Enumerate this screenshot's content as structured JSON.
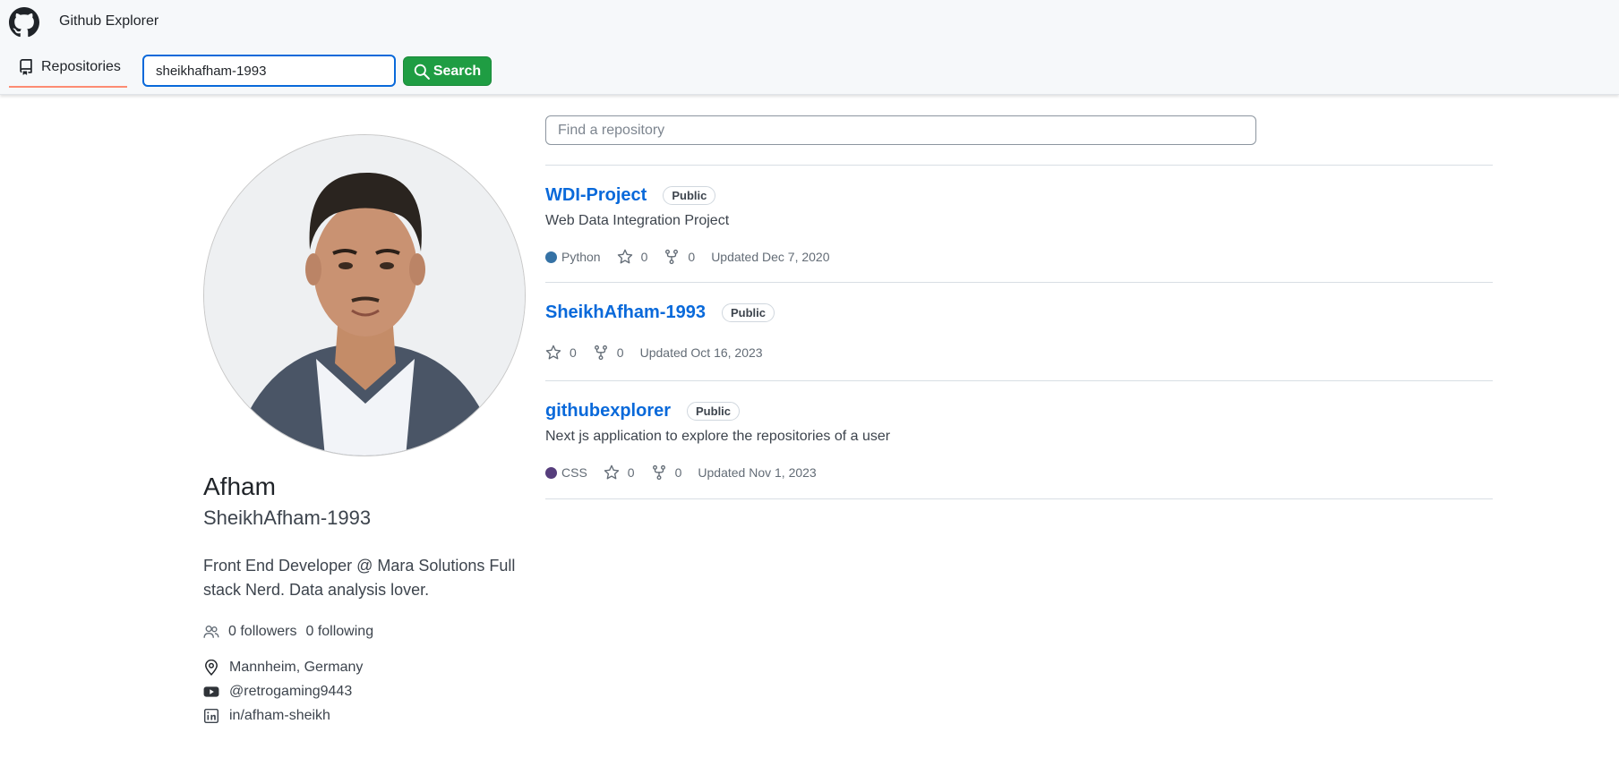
{
  "header": {
    "app_title": "Github Explorer",
    "tab_repositories": "Repositories",
    "search_value": "sheikhafham-1993",
    "search_button": "Search",
    "logo_icon": "github-octocat-icon"
  },
  "profile": {
    "name": "Afham",
    "login": "SheikhAfham-1993",
    "bio": "Front End Developer @ Mara Solutions Full stack Nerd. Data analysis lover.",
    "followers": "0 followers",
    "following": "0 following",
    "location": "Mannheim, Germany",
    "youtube": "@retrogaming9443",
    "linkedin": "in/afham-sheikh"
  },
  "repo_filter": {
    "placeholder": "Find a repository"
  },
  "repos": [
    {
      "name": "WDI-Project",
      "visibility": "Public",
      "description": "Web Data Integration Project",
      "language": "Python",
      "language_color": "#3572A5",
      "stars": "0",
      "forks": "0",
      "updated": "Updated Dec 7, 2020"
    },
    {
      "name": "SheikhAfham-1993",
      "visibility": "Public",
      "description": "",
      "language": "",
      "language_color": "",
      "stars": "0",
      "forks": "0",
      "updated": "Updated Oct 16, 2023"
    },
    {
      "name": "githubexplorer",
      "visibility": "Public",
      "description": "Next js application to explore the repositories of a user",
      "language": "CSS",
      "language_color": "#563d7c",
      "stars": "0",
      "forks": "0",
      "updated": "Updated Nov 1, 2023"
    }
  ],
  "colors": {
    "accent_blue": "#0969da",
    "search_green": "#1f9d43",
    "tab_underline": "#fd8c73"
  }
}
